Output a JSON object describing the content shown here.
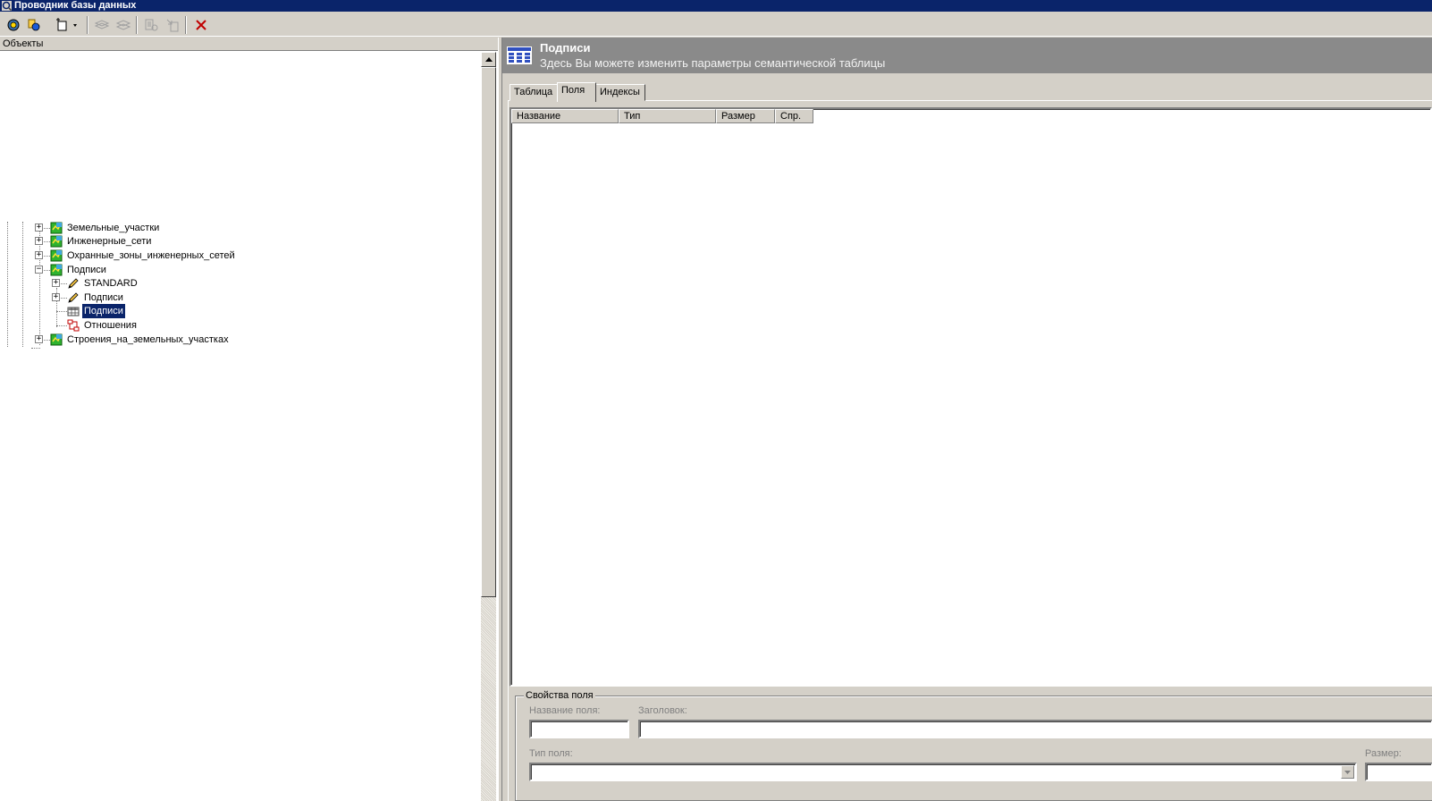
{
  "window": {
    "title": "Проводник базы данных"
  },
  "toolbar": {
    "buttons": [
      {
        "icon": "connect-icon"
      },
      {
        "icon": "database-icon"
      },
      {
        "icon": "new-object-dropdown-icon"
      },
      {
        "icon": "copy-layers-icon"
      },
      {
        "icon": "paste-layers-icon"
      },
      {
        "icon": "properties-icon"
      },
      {
        "icon": "import-icon"
      },
      {
        "icon": "delete-icon"
      }
    ]
  },
  "objects_panel": {
    "header": "Объекты",
    "tree": [
      {
        "label": "Земельные_участки",
        "level": 1,
        "expander": "+",
        "icon": "layer-icon"
      },
      {
        "label": "Инженерные_сети",
        "level": 1,
        "expander": "+",
        "icon": "layer-icon"
      },
      {
        "label": "Охранные_зоны_инженерных_сетей",
        "level": 1,
        "expander": "+",
        "icon": "layer-icon"
      },
      {
        "label": "Подписи",
        "level": 1,
        "expander": "−",
        "icon": "layer-icon"
      },
      {
        "label": "STANDARD",
        "level": 2,
        "expander": "+",
        "icon": "pencil-icon"
      },
      {
        "label": "Подписи",
        "level": 2,
        "expander": "+",
        "icon": "pencil-icon"
      },
      {
        "label": "Подписи",
        "level": 2,
        "expander": "",
        "icon": "table-icon",
        "selected": true
      },
      {
        "label": "Отношения",
        "level": 2,
        "expander": "",
        "icon": "relations-icon"
      },
      {
        "label": "Строения_на_земельных_участках",
        "level": 1,
        "expander": "+",
        "icon": "layer-icon"
      }
    ]
  },
  "details": {
    "title": "Подписи",
    "subtitle": "Здесь Вы можете изменить параметры семантической таблицы",
    "tabs": [
      {
        "label": "Таблица",
        "active": false
      },
      {
        "label": "Поля",
        "active": true
      },
      {
        "label": "Индексы",
        "active": false
      }
    ],
    "fields_table": {
      "columns": [
        "Название",
        "Тип",
        "Размер",
        "Спр."
      ],
      "rows": []
    },
    "field_properties": {
      "title": "Свойства поля",
      "name_label": "Название поля:",
      "name_value": "",
      "caption_label": "Заголовок:",
      "caption_value": "",
      "type_label": "Тип поля:",
      "type_value": "",
      "size_label": "Размер:"
    }
  },
  "colors": {
    "titlebar": "#0a246a",
    "header_bg": "#8a8a8a",
    "face": "#d4d0c8",
    "selection": "#0a246a",
    "delete_red": "#c00000"
  }
}
